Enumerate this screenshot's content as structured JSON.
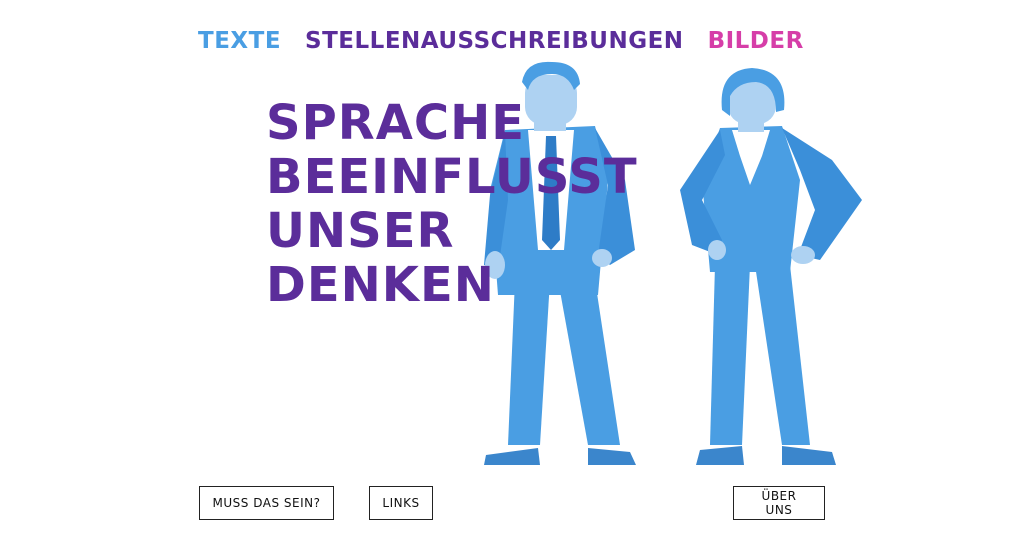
{
  "nav": {
    "texte": "TEXTE",
    "stellen": "STELLENAUSSCHREIBUNGEN",
    "bilder": "BILDER"
  },
  "headline": {
    "line1": "SPRACHE",
    "line2": "BEEINFLUSST",
    "line3": "UNSER",
    "line4": "DENKEN"
  },
  "buttons": {
    "muss": "MUSS DAS SEIN?",
    "links": "LINKS",
    "ueber": "ÜBER UNS"
  },
  "illustration": {
    "figures": [
      "man-in-suit",
      "woman-in-suit"
    ]
  },
  "colors": {
    "nav_texte": "#4a9ee3",
    "nav_stellen": "#5b2d9a",
    "nav_bilder": "#d63ea8",
    "headline": "#5b2d9a",
    "figure_blue": "#4a9ee3",
    "figure_light": "#aed2f2"
  }
}
